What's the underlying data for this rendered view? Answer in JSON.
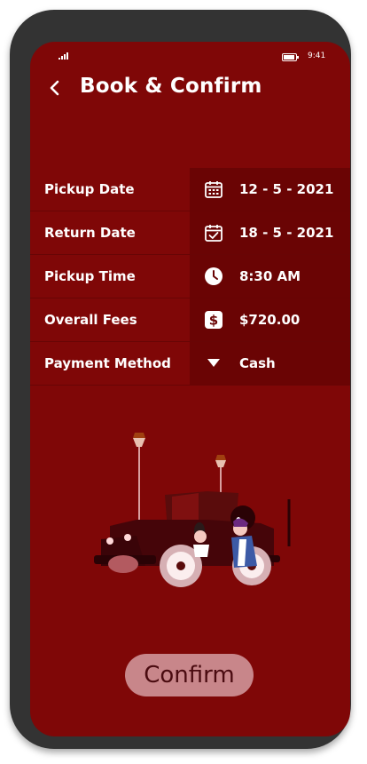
{
  "status_bar": {
    "time": "9:41",
    "signal_icon": "signal-icon",
    "battery_icon": "battery-icon"
  },
  "header": {
    "title": "Book & Confirm",
    "back_icon": "chevron-left-icon"
  },
  "details": [
    {
      "label": "Pickup Date",
      "value": "12 - 5 - 2021",
      "icon": "calendar-icon"
    },
    {
      "label": "Return Date",
      "value": "18 - 5 - 2021",
      "icon": "calendar-check-icon"
    },
    {
      "label": "Pickup Time",
      "value": "8:30 AM",
      "icon": "clock-icon"
    },
    {
      "label": "Overall Fees",
      "value": "$720.00",
      "icon": "dollar-icon"
    },
    {
      "label": "Payment Method",
      "value": "Cash",
      "icon": "dropdown-triangle-icon"
    }
  ],
  "confirm_button": {
    "label": "Confirm"
  },
  "colors": {
    "background": "#7f0707",
    "panel": "#6a0404",
    "button": "#c8868a",
    "button_text": "#4a0b10",
    "frame": "#333333"
  }
}
